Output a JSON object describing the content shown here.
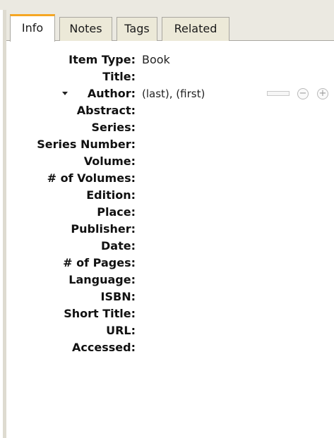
{
  "tabs": [
    "Info",
    "Notes",
    "Tags",
    "Related"
  ],
  "selected_tab": "Info",
  "fields": {
    "item_type_label": "Item Type:",
    "item_type_value": "Book",
    "title_label": "Title:",
    "author_label": "Author:",
    "author_value": "(last), (first)",
    "abstract_label": "Abstract:",
    "series_label": "Series:",
    "series_number_label": "Series Number:",
    "volume_label": "Volume:",
    "num_volumes_label": "# of Volumes:",
    "edition_label": "Edition:",
    "place_label": "Place:",
    "publisher_label": "Publisher:",
    "date_label": "Date:",
    "num_pages_label": "# of Pages:",
    "language_label": "Language:",
    "isbn_label": "ISBN:",
    "short_title_label": "Short Title:",
    "url_label": "URL:",
    "accessed_label": "Accessed:"
  },
  "icons": {
    "creator_twisty": "triangle-down-icon",
    "remove_creator": "minus-circle-icon",
    "add_creator": "plus-circle-icon"
  },
  "colors": {
    "selected_tab_accent": "#f5a623",
    "tab_background": "#ece9d8"
  }
}
